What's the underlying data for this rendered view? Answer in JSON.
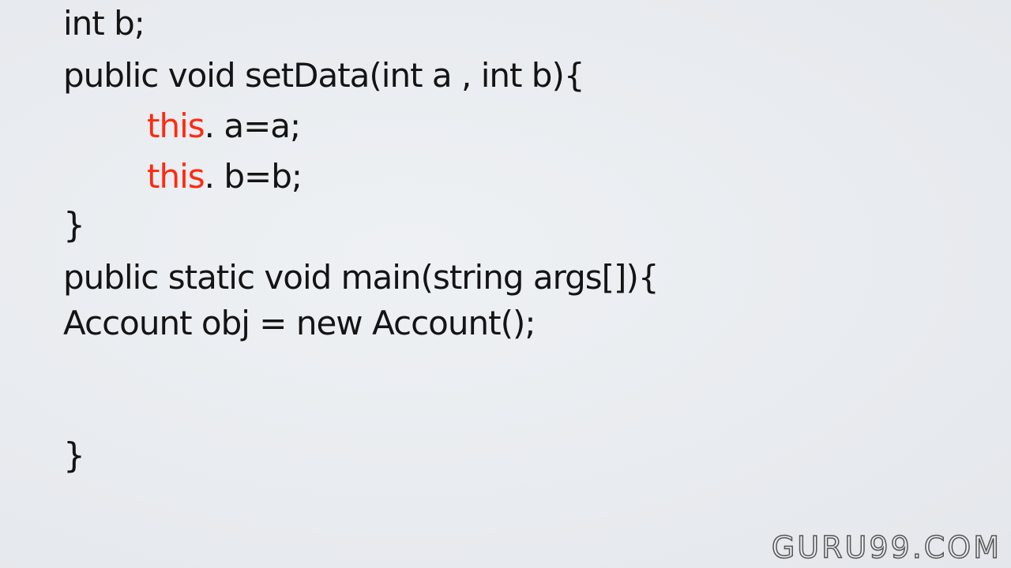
{
  "code": {
    "line1": "int b;",
    "line2": "public void setData(int a , int b){",
    "line3_keyword": "this",
    "line3_rest": ". a=a;",
    "line4_keyword": "this",
    "line4_rest": ". b=b;",
    "line5": "}",
    "line6": "public static void main(string args[]){",
    "line7": "Account obj = new Account();",
    "line8": "}"
  },
  "watermark": "GURU99.COM",
  "colors": {
    "background": "#e9ecf0",
    "text": "#141414",
    "keyword_this": "#ff2a10"
  }
}
